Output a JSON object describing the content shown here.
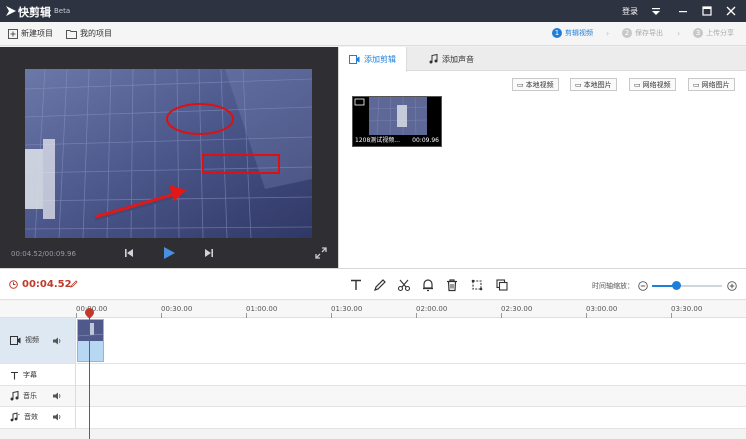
{
  "window": {
    "app_name": "快剪辑",
    "beta_label": "Beta",
    "login_label": "登录"
  },
  "menubar": {
    "new_project": "新建项目",
    "my_projects": "我的项目",
    "steps": [
      {
        "num": "1",
        "label": "剪辑视频"
      },
      {
        "num": "2",
        "label": "保存导出"
      },
      {
        "num": "3",
        "label": "上传分享"
      }
    ]
  },
  "preview": {
    "time_display": "00:04.52/00:09.96"
  },
  "media_panel": {
    "tabs": [
      {
        "label": "添加剪辑"
      },
      {
        "label": "添加声音"
      }
    ],
    "source_buttons": [
      {
        "label": "本地视频"
      },
      {
        "label": "本地图片"
      },
      {
        "label": "网络视频"
      },
      {
        "label": "网络图片"
      }
    ],
    "clip": {
      "name": "1208测试视频...",
      "duration": "00:09.96"
    }
  },
  "toolbar": {
    "current_time": "00:04.52",
    "zoom_label": "时间轴缩放：",
    "zoom_level": 0.35
  },
  "timeline": {
    "ticks": [
      "00:00.00",
      "00:30.00",
      "01:00.00",
      "01:30.00",
      "02:00.00",
      "02:30.00",
      "03:00.00",
      "03:30.00"
    ],
    "tracks": [
      {
        "label": "视频",
        "icon": "video-icon"
      },
      {
        "label": "字幕",
        "icon": "text-icon"
      },
      {
        "label": "音乐",
        "icon": "music-icon"
      },
      {
        "label": "音效",
        "icon": "sound-effect-icon"
      }
    ]
  },
  "colors": {
    "accent": "#1e7ed8",
    "titlebar": "#2d3340",
    "playhead": "#c0392b"
  }
}
